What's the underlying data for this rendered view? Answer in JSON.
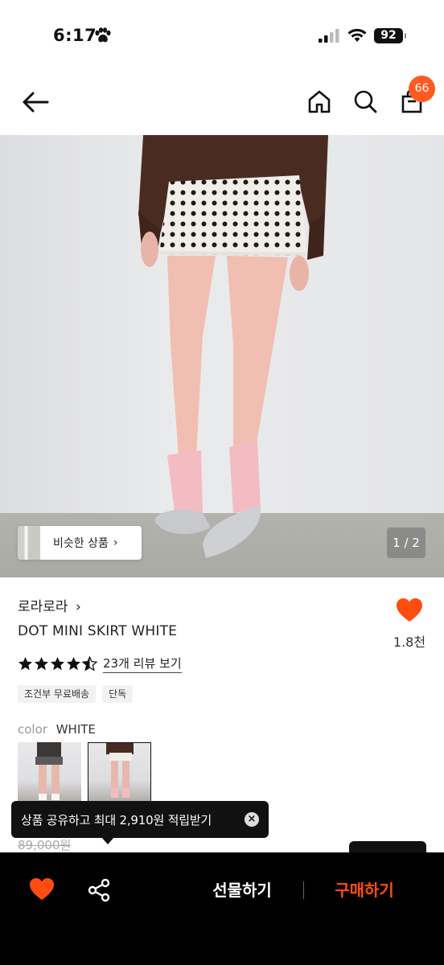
{
  "status_bar": {
    "time": "6:17",
    "battery": "92"
  },
  "header": {
    "cart_count": "66"
  },
  "gallery": {
    "similar_label": "비슷한 상품",
    "similar_chevron": "›",
    "counter": "1 / 2"
  },
  "product": {
    "brand": "로라로라",
    "brand_chevron": "›",
    "name": "DOT MINI SKIRT WHITE",
    "like_count": "1.8천",
    "rating": 4.5,
    "review_link": "23개 리뷰 보기",
    "tags": [
      "조건부 무료배송",
      "단독"
    ],
    "color_label": "color",
    "color_value": "WHITE",
    "original_price": "89,000원"
  },
  "tooltip": {
    "text": "상품 공유하고 최대 2,910원 적립받기",
    "close": "×"
  },
  "bottom_bar": {
    "gift_label": "선물하기",
    "buy_label": "구매하기"
  },
  "colors": {
    "accent": "#ff5a1f",
    "buy": "#ff4d10",
    "heart": "#ff4d10"
  }
}
